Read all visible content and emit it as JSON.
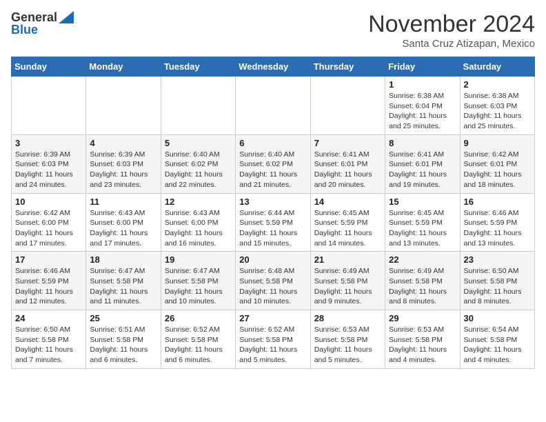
{
  "header": {
    "logo_general": "General",
    "logo_blue": "Blue",
    "month": "November 2024",
    "location": "Santa Cruz Atizapan, Mexico"
  },
  "days_of_week": [
    "Sunday",
    "Monday",
    "Tuesday",
    "Wednesday",
    "Thursday",
    "Friday",
    "Saturday"
  ],
  "weeks": [
    [
      {
        "day": "",
        "info": ""
      },
      {
        "day": "",
        "info": ""
      },
      {
        "day": "",
        "info": ""
      },
      {
        "day": "",
        "info": ""
      },
      {
        "day": "",
        "info": ""
      },
      {
        "day": "1",
        "info": "Sunrise: 6:38 AM\nSunset: 6:04 PM\nDaylight: 11 hours and 25 minutes."
      },
      {
        "day": "2",
        "info": "Sunrise: 6:38 AM\nSunset: 6:03 PM\nDaylight: 11 hours and 25 minutes."
      }
    ],
    [
      {
        "day": "3",
        "info": "Sunrise: 6:39 AM\nSunset: 6:03 PM\nDaylight: 11 hours and 24 minutes."
      },
      {
        "day": "4",
        "info": "Sunrise: 6:39 AM\nSunset: 6:03 PM\nDaylight: 11 hours and 23 minutes."
      },
      {
        "day": "5",
        "info": "Sunrise: 6:40 AM\nSunset: 6:02 PM\nDaylight: 11 hours and 22 minutes."
      },
      {
        "day": "6",
        "info": "Sunrise: 6:40 AM\nSunset: 6:02 PM\nDaylight: 11 hours and 21 minutes."
      },
      {
        "day": "7",
        "info": "Sunrise: 6:41 AM\nSunset: 6:01 PM\nDaylight: 11 hours and 20 minutes."
      },
      {
        "day": "8",
        "info": "Sunrise: 6:41 AM\nSunset: 6:01 PM\nDaylight: 11 hours and 19 minutes."
      },
      {
        "day": "9",
        "info": "Sunrise: 6:42 AM\nSunset: 6:01 PM\nDaylight: 11 hours and 18 minutes."
      }
    ],
    [
      {
        "day": "10",
        "info": "Sunrise: 6:42 AM\nSunset: 6:00 PM\nDaylight: 11 hours and 17 minutes."
      },
      {
        "day": "11",
        "info": "Sunrise: 6:43 AM\nSunset: 6:00 PM\nDaylight: 11 hours and 17 minutes."
      },
      {
        "day": "12",
        "info": "Sunrise: 6:43 AM\nSunset: 6:00 PM\nDaylight: 11 hours and 16 minutes."
      },
      {
        "day": "13",
        "info": "Sunrise: 6:44 AM\nSunset: 5:59 PM\nDaylight: 11 hours and 15 minutes."
      },
      {
        "day": "14",
        "info": "Sunrise: 6:45 AM\nSunset: 5:59 PM\nDaylight: 11 hours and 14 minutes."
      },
      {
        "day": "15",
        "info": "Sunrise: 6:45 AM\nSunset: 5:59 PM\nDaylight: 11 hours and 13 minutes."
      },
      {
        "day": "16",
        "info": "Sunrise: 6:46 AM\nSunset: 5:59 PM\nDaylight: 11 hours and 13 minutes."
      }
    ],
    [
      {
        "day": "17",
        "info": "Sunrise: 6:46 AM\nSunset: 5:59 PM\nDaylight: 11 hours and 12 minutes."
      },
      {
        "day": "18",
        "info": "Sunrise: 6:47 AM\nSunset: 5:58 PM\nDaylight: 11 hours and 11 minutes."
      },
      {
        "day": "19",
        "info": "Sunrise: 6:47 AM\nSunset: 5:58 PM\nDaylight: 11 hours and 10 minutes."
      },
      {
        "day": "20",
        "info": "Sunrise: 6:48 AM\nSunset: 5:58 PM\nDaylight: 11 hours and 10 minutes."
      },
      {
        "day": "21",
        "info": "Sunrise: 6:49 AM\nSunset: 5:58 PM\nDaylight: 11 hours and 9 minutes."
      },
      {
        "day": "22",
        "info": "Sunrise: 6:49 AM\nSunset: 5:58 PM\nDaylight: 11 hours and 8 minutes."
      },
      {
        "day": "23",
        "info": "Sunrise: 6:50 AM\nSunset: 5:58 PM\nDaylight: 11 hours and 8 minutes."
      }
    ],
    [
      {
        "day": "24",
        "info": "Sunrise: 6:50 AM\nSunset: 5:58 PM\nDaylight: 11 hours and 7 minutes."
      },
      {
        "day": "25",
        "info": "Sunrise: 6:51 AM\nSunset: 5:58 PM\nDaylight: 11 hours and 6 minutes."
      },
      {
        "day": "26",
        "info": "Sunrise: 6:52 AM\nSunset: 5:58 PM\nDaylight: 11 hours and 6 minutes."
      },
      {
        "day": "27",
        "info": "Sunrise: 6:52 AM\nSunset: 5:58 PM\nDaylight: 11 hours and 5 minutes."
      },
      {
        "day": "28",
        "info": "Sunrise: 6:53 AM\nSunset: 5:58 PM\nDaylight: 11 hours and 5 minutes."
      },
      {
        "day": "29",
        "info": "Sunrise: 6:53 AM\nSunset: 5:58 PM\nDaylight: 11 hours and 4 minutes."
      },
      {
        "day": "30",
        "info": "Sunrise: 6:54 AM\nSunset: 5:58 PM\nDaylight: 11 hours and 4 minutes."
      }
    ]
  ]
}
